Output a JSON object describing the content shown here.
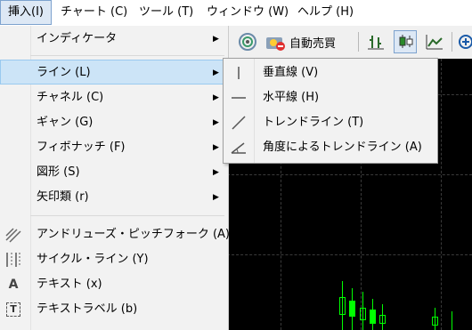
{
  "menubar": {
    "items": [
      {
        "label": "挿入(I)"
      },
      {
        "label": "チャート (C)"
      },
      {
        "label": "ツール (T)"
      },
      {
        "label": "ウィンドウ (W)"
      },
      {
        "label": "ヘルプ (H)"
      }
    ]
  },
  "toolbar": {
    "autotrade_label": "自動売買"
  },
  "insert_menu": {
    "items": [
      {
        "label": "インディケータ",
        "arrow": "▶"
      },
      {
        "label": "ライン (L)",
        "arrow": "▶"
      },
      {
        "label": "チャネル (C)",
        "arrow": "▶"
      },
      {
        "label": "ギャン (G)",
        "arrow": "▶"
      },
      {
        "label": "フィボナッチ (F)",
        "arrow": "▶"
      },
      {
        "label": "図形 (S)",
        "arrow": "▶"
      },
      {
        "label": "矢印類 (r)",
        "arrow": "▶"
      },
      {
        "label": "アンドリューズ・ピッチフォーク (A)"
      },
      {
        "label": "サイクル・ライン (Y)"
      },
      {
        "label": "テキスト (x)",
        "icon_text": "A"
      },
      {
        "label": "テキストラベル (b)",
        "icon_text": "T"
      }
    ]
  },
  "line_submenu": {
    "items": [
      {
        "label": "垂直線 (V)"
      },
      {
        "label": "水平線 (H)"
      },
      {
        "label": "トレンドライン (T)"
      },
      {
        "label": "角度によるトレンドライン (A)"
      }
    ]
  }
}
